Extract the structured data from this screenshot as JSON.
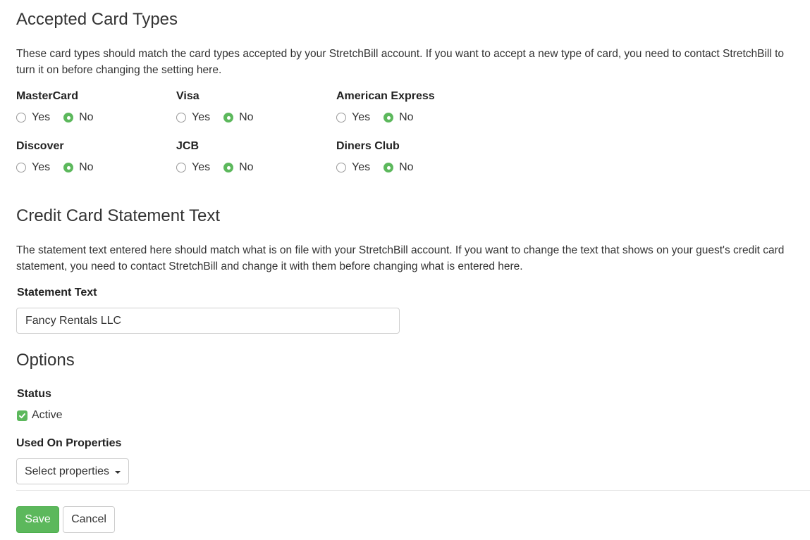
{
  "accepted_cards": {
    "heading": "Accepted Card Types",
    "description": "These card types should match the card types accepted by your StretchBill account. If you want to accept a new type of card, you need to contact StretchBill to turn it on before changing the setting here.",
    "yes_label": "Yes",
    "no_label": "No",
    "cards": [
      {
        "name": "MasterCard",
        "value": "No"
      },
      {
        "name": "Visa",
        "value": "No"
      },
      {
        "name": "American Express",
        "value": "No"
      },
      {
        "name": "Discover",
        "value": "No"
      },
      {
        "name": "JCB",
        "value": "No"
      },
      {
        "name": "Diners Club",
        "value": "No"
      }
    ]
  },
  "statement": {
    "heading": "Credit Card Statement Text",
    "description": "The statement text entered here should match what is on file with your StretchBill account. If you want to change the text that shows on your guest's credit card statement, you need to contact StretchBill and change it with them before changing what is entered here.",
    "field_label": "Statement Text",
    "field_value": "Fancy Rentals LLC"
  },
  "options": {
    "heading": "Options",
    "status_label": "Status",
    "active_label": "Active",
    "active_checked": true,
    "properties_label": "Used On Properties",
    "properties_button": "Select properties"
  },
  "actions": {
    "save": "Save",
    "cancel": "Cancel"
  },
  "colors": {
    "accent": "#5cb85c"
  }
}
